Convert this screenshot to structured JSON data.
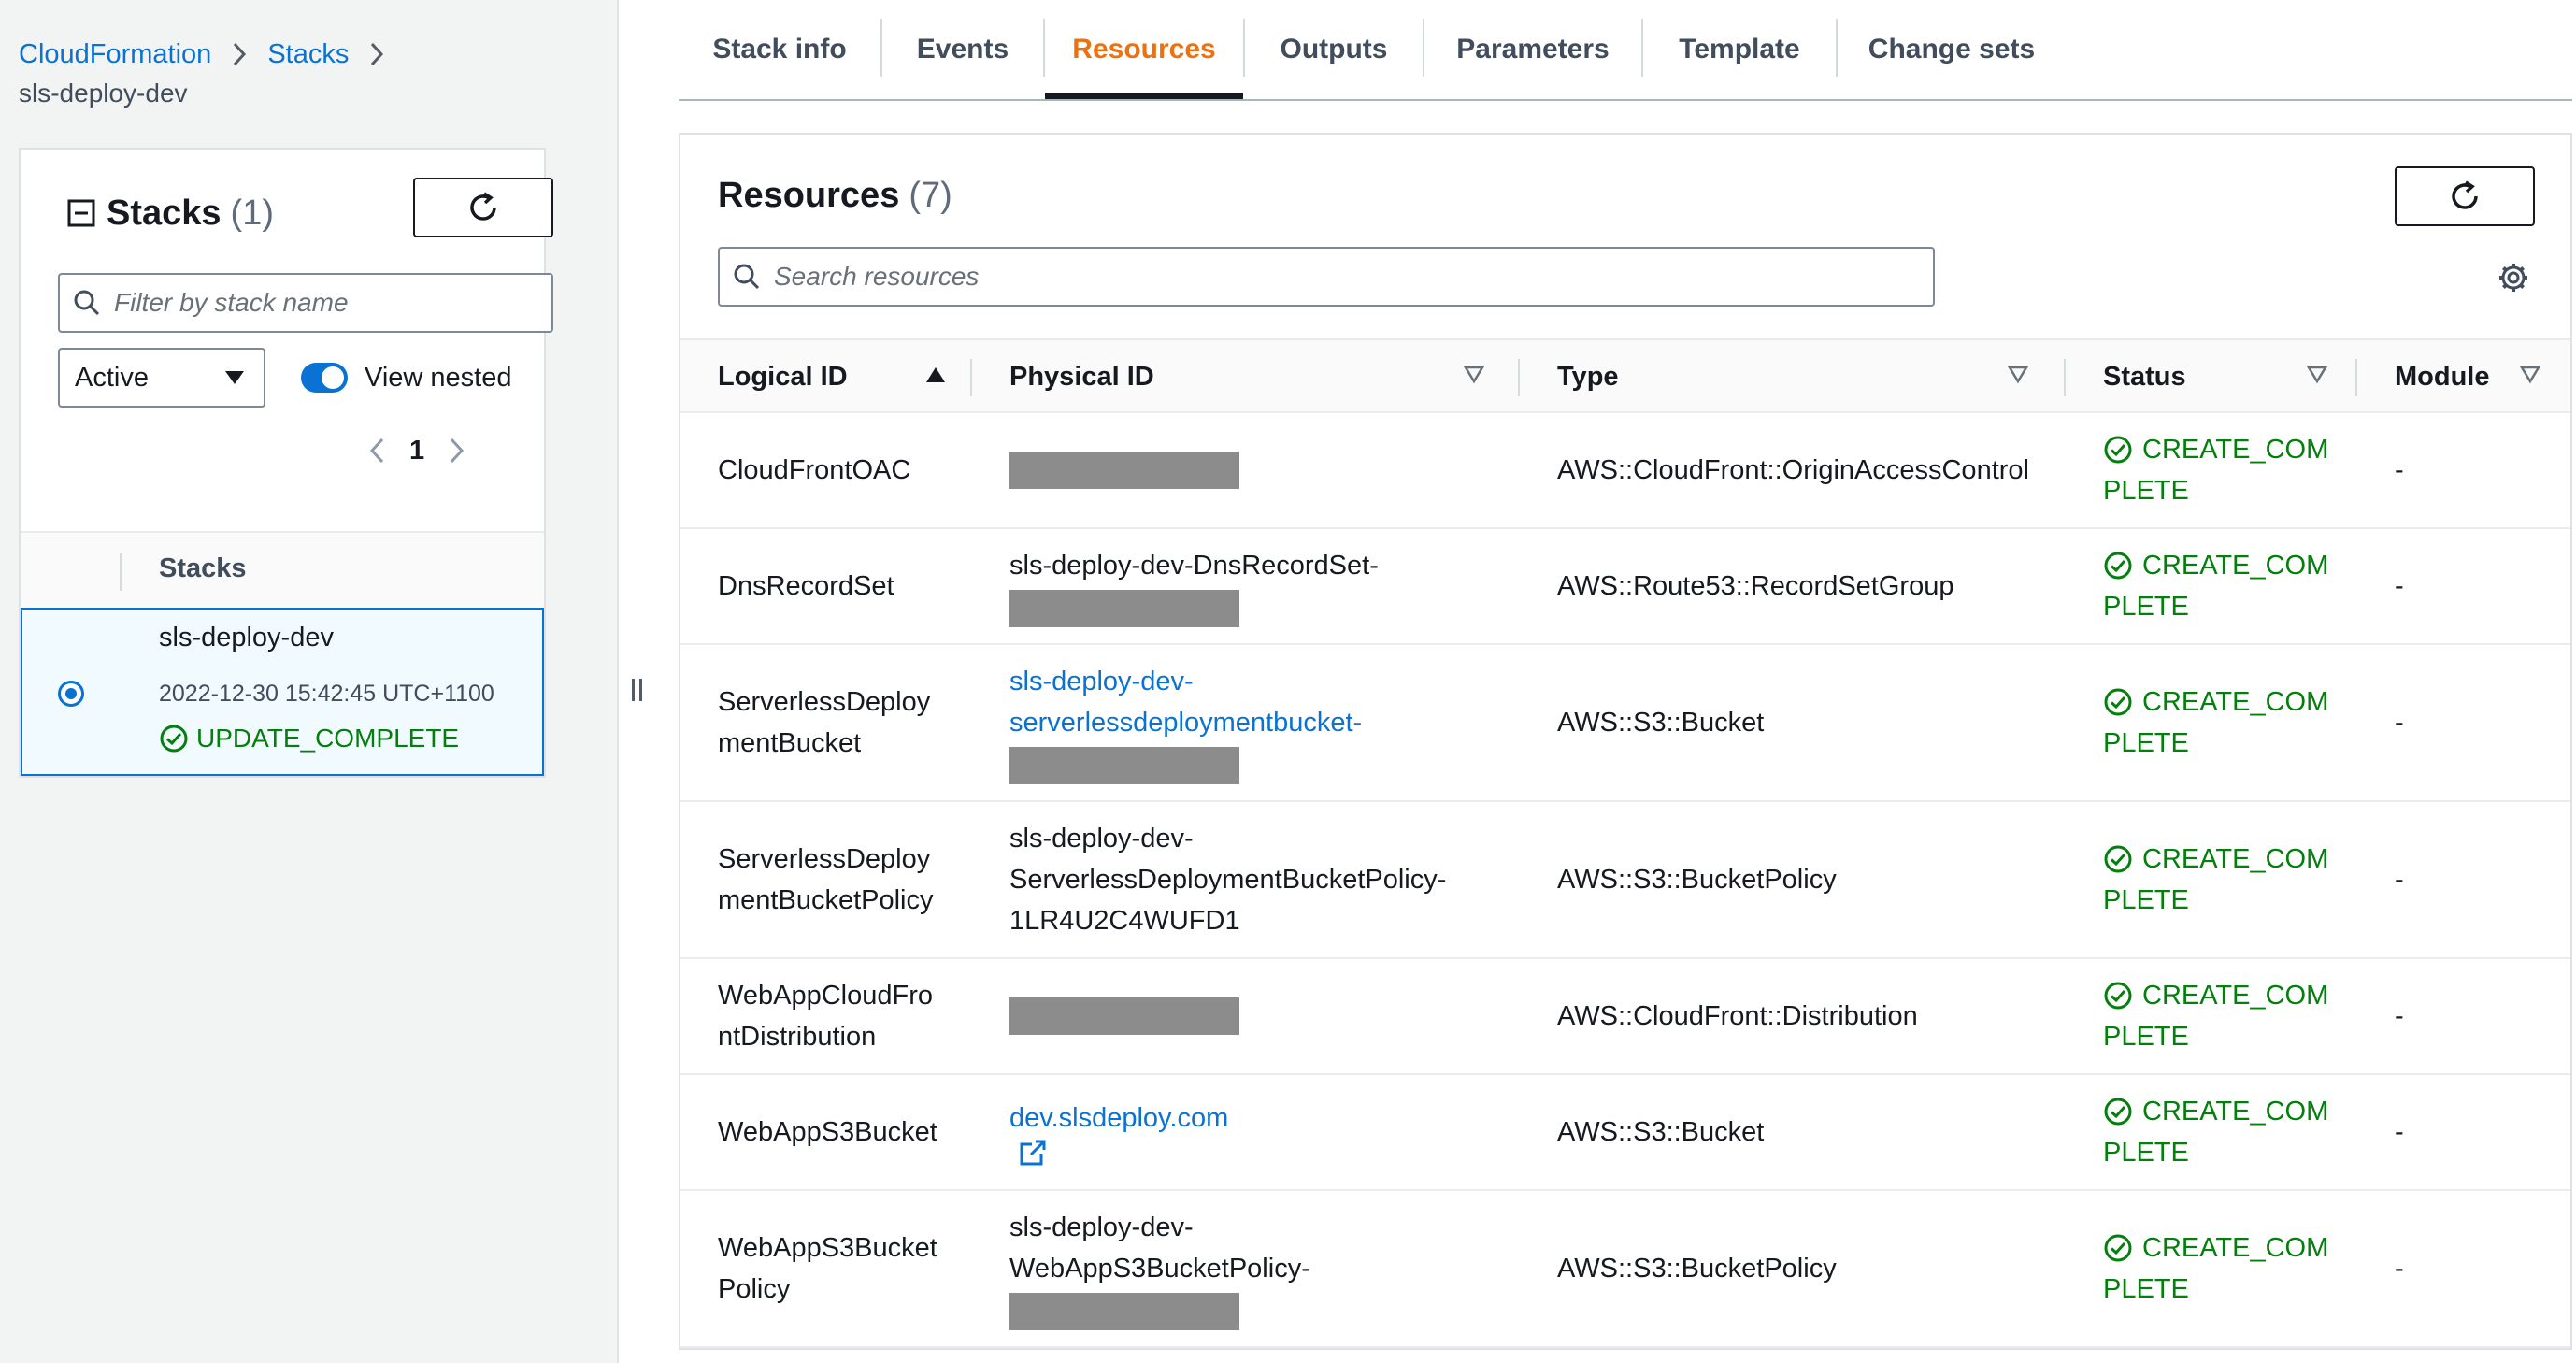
{
  "breadcrumb": {
    "items": [
      "CloudFormation",
      "Stacks"
    ],
    "current": "sls-deploy-dev"
  },
  "stacks_panel": {
    "title": "Stacks",
    "count": "(1)",
    "filter_placeholder": "Filter by stack name",
    "status_filter": "Active",
    "view_nested_label": "View nested",
    "view_nested_on": true,
    "page": "1",
    "column_header": "Stacks",
    "stack": {
      "name": "sls-deploy-dev",
      "timestamp": "2022-12-30 15:42:45 UTC+1100",
      "status": "UPDATE_COMPLETE"
    }
  },
  "tabs": [
    {
      "label": "Stack info",
      "active": false
    },
    {
      "label": "Events",
      "active": false
    },
    {
      "label": "Resources",
      "active": true
    },
    {
      "label": "Outputs",
      "active": false
    },
    {
      "label": "Parameters",
      "active": false
    },
    {
      "label": "Template",
      "active": false
    },
    {
      "label": "Change sets",
      "active": false
    }
  ],
  "resources": {
    "title": "Resources",
    "count": "(7)",
    "search_placeholder": "Search resources",
    "columns": {
      "logical_id": "Logical ID",
      "physical_id": "Physical ID",
      "type": "Type",
      "status": "Status",
      "module": "Module"
    },
    "rows": [
      {
        "logical": [
          "CloudFrontOAC"
        ],
        "physical": [],
        "redacted": true,
        "type": "AWS::CloudFront::OriginAccessControl",
        "status": [
          "CREATE_COM",
          "PLETE"
        ],
        "module": "-"
      },
      {
        "logical": [
          "DnsRecordSet"
        ],
        "physical": [
          "sls-deploy-dev-DnsRecordSet-"
        ],
        "redacted": true,
        "type": "AWS::Route53::RecordSetGroup",
        "status": [
          "CREATE_COM",
          "PLETE"
        ],
        "module": "-"
      },
      {
        "logical": [
          "ServerlessDeploy",
          "mentBucket"
        ],
        "physical": [
          "sls-deploy-dev-",
          "serverlessdeploymentbucket-"
        ],
        "physical_link": true,
        "redacted": true,
        "type": "AWS::S3::Bucket",
        "status": [
          "CREATE_COM",
          "PLETE"
        ],
        "module": "-"
      },
      {
        "logical": [
          "ServerlessDeploy",
          "mentBucketPolicy"
        ],
        "physical": [
          "sls-deploy-dev-",
          "ServerlessDeploymentBucketPolicy-",
          "1LR4U2C4WUFD1"
        ],
        "redacted": false,
        "type": "AWS::S3::BucketPolicy",
        "status": [
          "CREATE_COM",
          "PLETE"
        ],
        "module": "-"
      },
      {
        "logical": [
          "WebAppCloudFro",
          "ntDistribution"
        ],
        "physical": [],
        "redacted": true,
        "type": "AWS::CloudFront::Distribution",
        "status": [
          "CREATE_COM",
          "PLETE"
        ],
        "module": "-"
      },
      {
        "logical": [
          "WebAppS3Bucket"
        ],
        "physical": [
          "dev.slsdeploy.com"
        ],
        "physical_link": true,
        "external_icon": "external-link-icon",
        "redacted": false,
        "type": "AWS::S3::Bucket",
        "status": [
          "CREATE_COM",
          "PLETE"
        ],
        "module": "-"
      },
      {
        "logical": [
          "WebAppS3Bucket",
          "Policy"
        ],
        "physical": [
          "sls-deploy-dev-",
          "WebAppS3BucketPolicy-"
        ],
        "redacted": true,
        "type": "AWS::S3::BucketPolicy",
        "status": [
          "CREATE_COM",
          "PLETE"
        ],
        "module": "-"
      }
    ]
  },
  "colors": {
    "link": "#0972d3",
    "active_tab": "#ec7211",
    "success": "#037f0c",
    "redaction": "#8c8c8c"
  },
  "icons": [
    "search-icon",
    "refresh-icon",
    "collapse-icon",
    "caret-down-icon",
    "chevron-left-icon",
    "chevron-right-icon",
    "check-circle-icon",
    "gear-icon",
    "sort-ascending-icon",
    "sort-icon",
    "external-link-icon"
  ]
}
